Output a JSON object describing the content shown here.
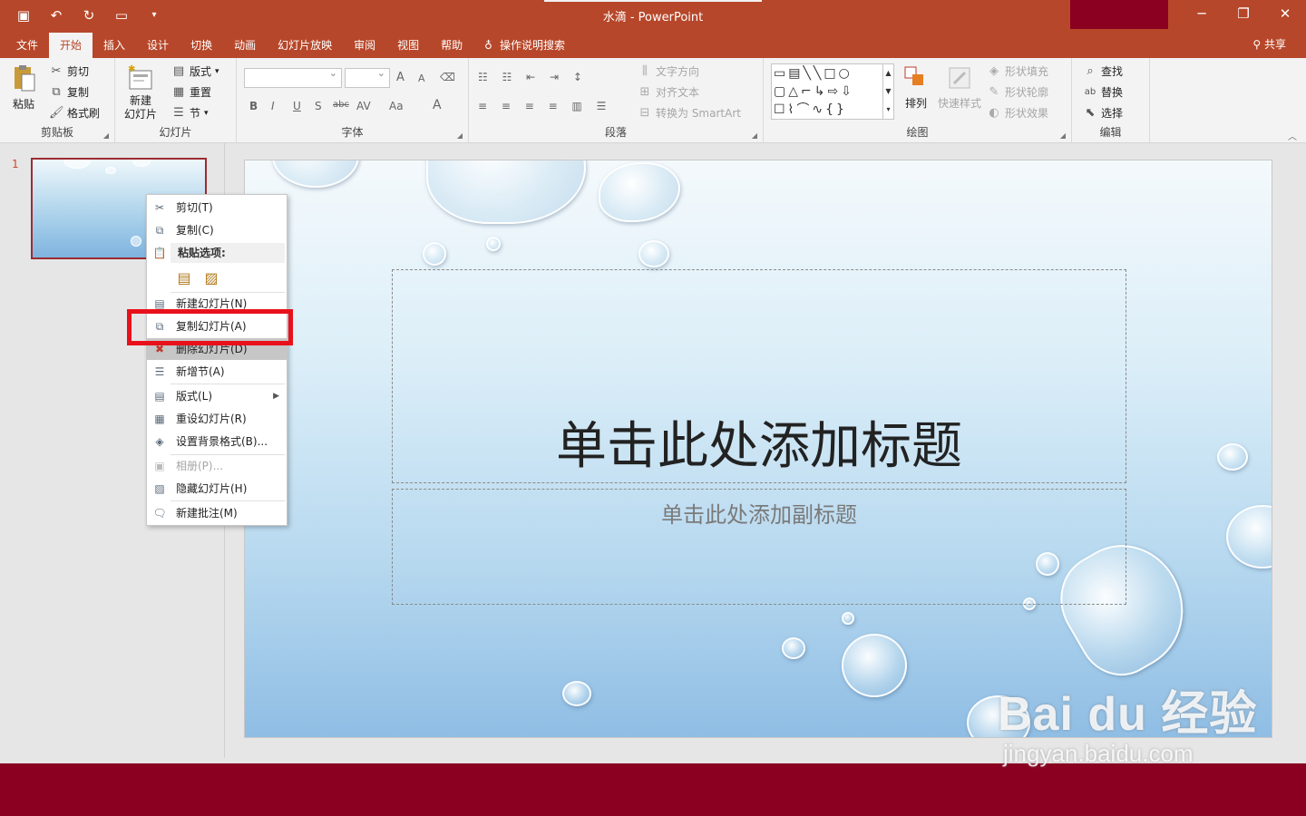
{
  "window": {
    "title": "水滴  -  PowerPoint",
    "accent_color": "#b7472a",
    "status_color": "#8b0020"
  },
  "qat": [
    "save-icon",
    "undo-icon",
    "redo-icon",
    "present-icon",
    "customize-icon"
  ],
  "tabs": [
    {
      "label": "文件"
    },
    {
      "label": "开始"
    },
    {
      "label": "插入"
    },
    {
      "label": "设计"
    },
    {
      "label": "切换"
    },
    {
      "label": "动画"
    },
    {
      "label": "幻灯片放映"
    },
    {
      "label": "审阅"
    },
    {
      "label": "视图"
    },
    {
      "label": "帮助"
    }
  ],
  "active_tab": "开始",
  "search_label": "操作说明搜索",
  "share_label": "共享",
  "ribbon": {
    "clipboard": {
      "name": "剪贴板",
      "paste": "粘贴",
      "cut": "剪切",
      "copy": "复制",
      "format_painter": "格式刷"
    },
    "slides": {
      "name": "幻灯片",
      "new_slide_1": "新建",
      "new_slide_2": "幻灯片",
      "layout": "版式",
      "reset": "重置",
      "section": "节"
    },
    "font": {
      "name": "字体",
      "bold": "B",
      "italic": "I",
      "underline": "U",
      "shadow": "S",
      "strike": "abc",
      "spacing": "AV",
      "case": "Aa",
      "color": "A",
      "grow": "A",
      "shrink": "A"
    },
    "paragraph": {
      "name": "段落",
      "text_direction": "文字方向",
      "align_text": "对齐文本",
      "smartart": "转换为 SmartArt"
    },
    "drawing": {
      "name": "绘图",
      "arrange": "排列",
      "quick_styles": "快速样式",
      "fill": "形状填充",
      "outline": "形状轮廓",
      "effects": "形状效果"
    },
    "editing": {
      "name": "编辑",
      "find": "查找",
      "replace": "替换",
      "select": "选择"
    }
  },
  "slide_panel": {
    "slide_number": "1"
  },
  "slide": {
    "title_placeholder": "单击此处添加标题",
    "subtitle_placeholder": "单击此处添加副标题"
  },
  "context_menu": {
    "cut": "剪切(T)",
    "copy": "复制(C)",
    "paste_options": "粘贴选项:",
    "new_slide": "新建幻灯片(N)",
    "duplicate_slide": "复制幻灯片(A)",
    "delete_slide": "删除幻灯片(D)",
    "add_section": "新增节(A)",
    "layout": "版式(L)",
    "reset_slide": "重设幻灯片(R)",
    "format_background": "设置背景格式(B)...",
    "photo_album": "相册(P)...",
    "hide_slide": "隐藏幻灯片(H)",
    "new_comment": "新建批注(M)"
  },
  "highlight_color": "#e8111b",
  "watermark": {
    "logo": "Bai du 经验",
    "url": "jingyan.baidu.com"
  }
}
